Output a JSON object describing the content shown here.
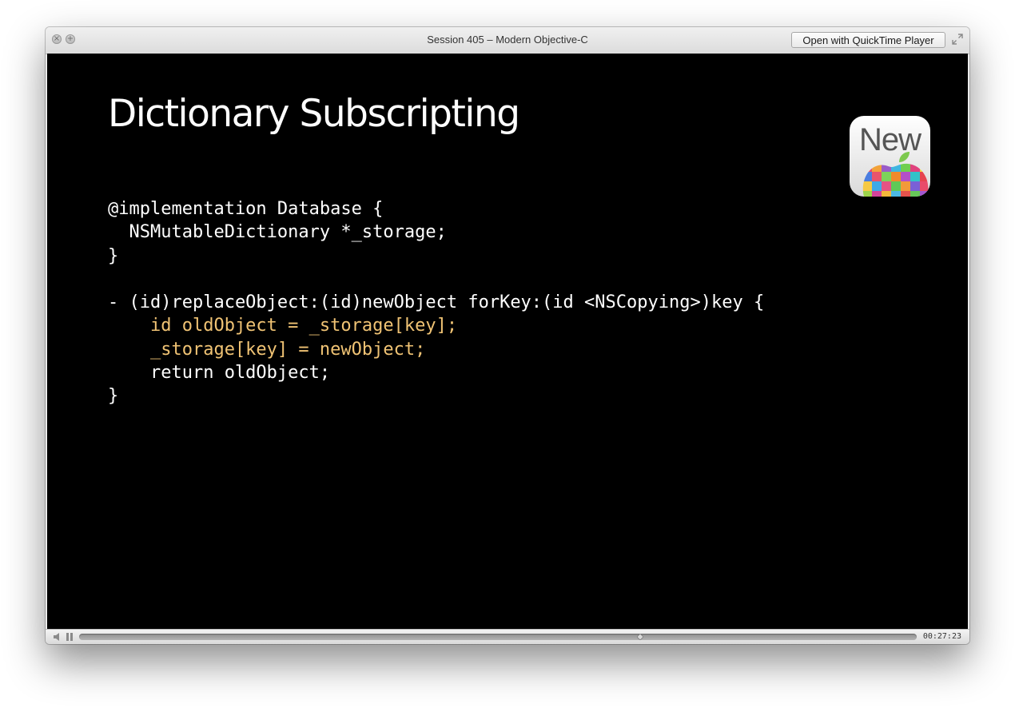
{
  "window": {
    "title": "Session 405 – Modern Objective-C",
    "open_button_label": "Open with QuickTime Player",
    "icons": {
      "close": "close-icon",
      "zoom": "zoom-icon",
      "fullscreen": "fullscreen-icon"
    }
  },
  "slide": {
    "title": "Dictionary Subscripting",
    "badge_text": "New",
    "code_lines": [
      {
        "text": "@implementation Database {",
        "highlight": false
      },
      {
        "text": "  NSMutableDictionary *_storage;",
        "highlight": false
      },
      {
        "text": "}",
        "highlight": false
      },
      {
        "text": "",
        "highlight": false
      },
      {
        "text": "- (id)replaceObject:(id)newObject forKey:(id <NSCopying>)key {",
        "highlight": false
      },
      {
        "text": "    id oldObject = _storage[key];",
        "highlight": true
      },
      {
        "text": "    _storage[key] = newObject;",
        "highlight": true
      },
      {
        "text": "    return oldObject;",
        "highlight": false
      },
      {
        "text": "}",
        "highlight": false
      }
    ],
    "colors": {
      "background": "#000000",
      "text": "#ffffff",
      "highlight": "#f0c374"
    }
  },
  "controls": {
    "timecode": "00:27:23",
    "progress_fraction": 0.67,
    "icons": {
      "volume": "volume-icon",
      "pause": "pause-icon",
      "playhead": "playhead-icon"
    }
  }
}
